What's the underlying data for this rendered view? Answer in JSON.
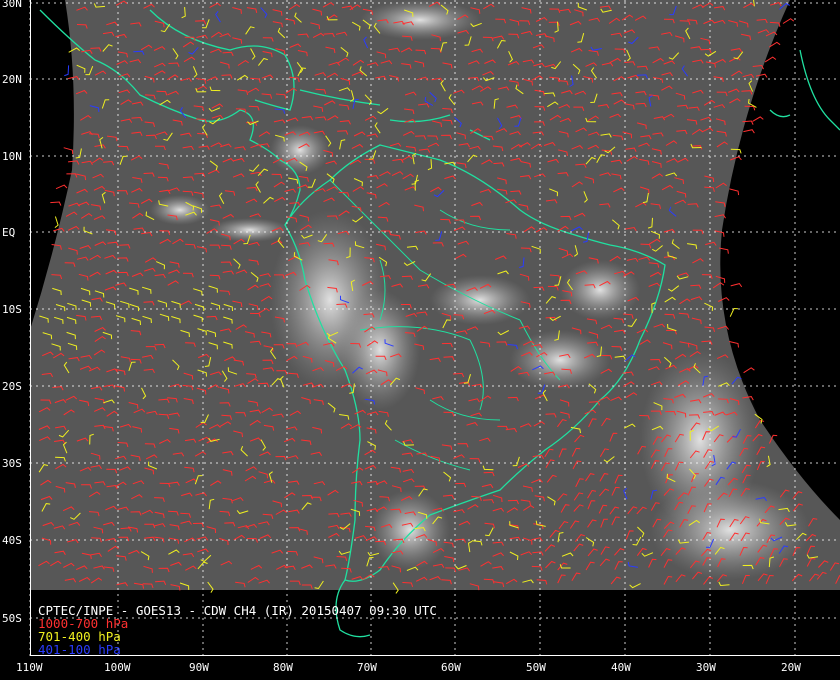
{
  "title_line": "CPTEC/INPE - GOES13 - CDW CH4 (IR) 20150407 09:30 UTC",
  "legend": [
    {
      "label": "1000-700 hPa",
      "color": "#ff3030"
    },
    {
      "label": "701-400 hPa",
      "color": "#f0f020"
    },
    {
      "label": "401-100 hPa",
      "color": "#2a3cff"
    }
  ],
  "lat_labels": [
    "30N",
    "20N",
    "10N",
    "EQ",
    "10S",
    "20S",
    "30S",
    "40S",
    "50S"
  ],
  "lon_labels": [
    "110W",
    "100W",
    "90W",
    "80W",
    "70W",
    "60W",
    "50W",
    "40W",
    "30W",
    "20W"
  ],
  "colors": {
    "coastline": "#20e0a0",
    "grid": "#ffffff",
    "background": "#000000",
    "earth_disk": "#5a5a5a"
  }
}
